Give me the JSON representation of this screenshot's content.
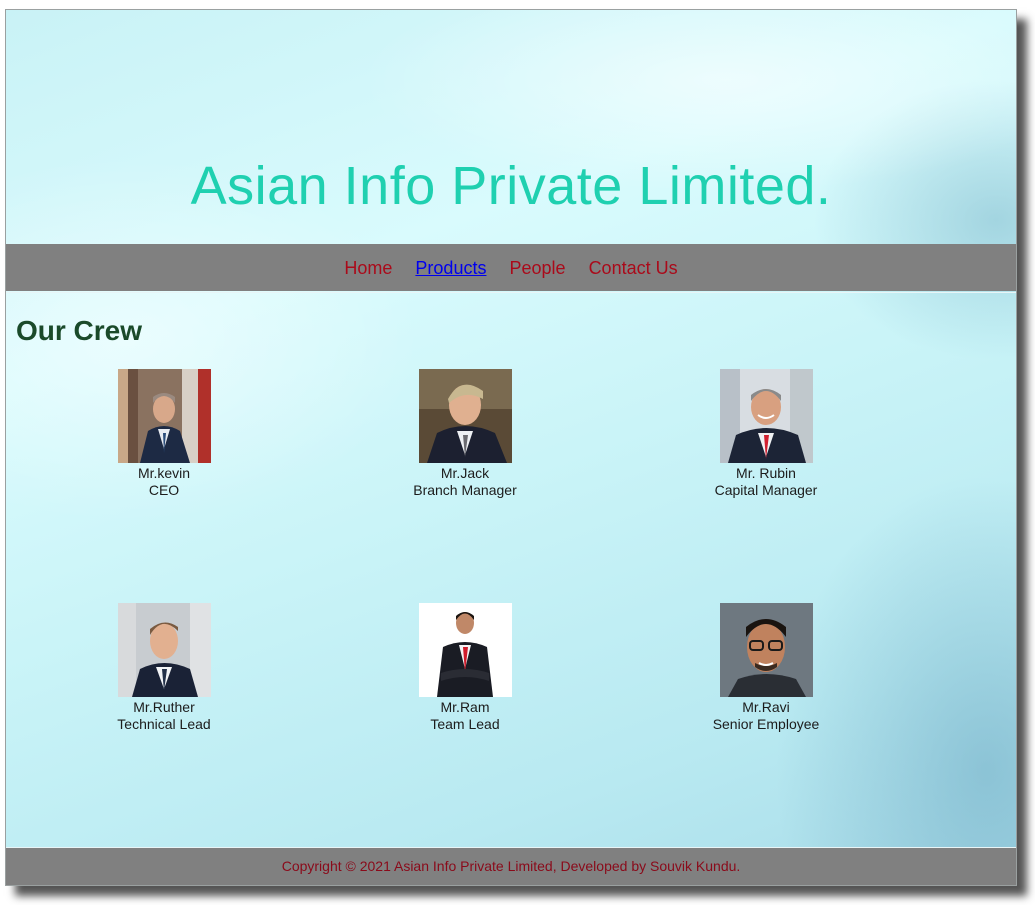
{
  "header": {
    "title": "Asian Info Private Limited."
  },
  "nav": {
    "items": [
      {
        "label": "Home"
      },
      {
        "label": "Products"
      },
      {
        "label": "People"
      },
      {
        "label": "Contact Us"
      }
    ],
    "active": "Products"
  },
  "crew": {
    "heading": "Our Crew",
    "members": [
      {
        "name": "Mr.kevin",
        "role": "CEO"
      },
      {
        "name": "Mr.Jack",
        "role": "Branch Manager"
      },
      {
        "name": "Mr. Rubin",
        "role": "Capital Manager"
      },
      {
        "name": "Mr.Ruther",
        "role": "Technical Lead"
      },
      {
        "name": "Mr.Ram",
        "role": "Team Lead"
      },
      {
        "name": "Mr.Ravi",
        "role": "Senior Employee"
      }
    ]
  },
  "footer": {
    "text": "Copyright © 2021 Asian Info Private Limited, Developed by Souvik Kundu."
  },
  "colors": {
    "title": "#1fd0b0",
    "nav_link": "#aa0a1a",
    "nav_active": "#0000ee",
    "bar": "#808080",
    "heading": "#1a4a2a",
    "footer_text": "#8a0a1a"
  }
}
